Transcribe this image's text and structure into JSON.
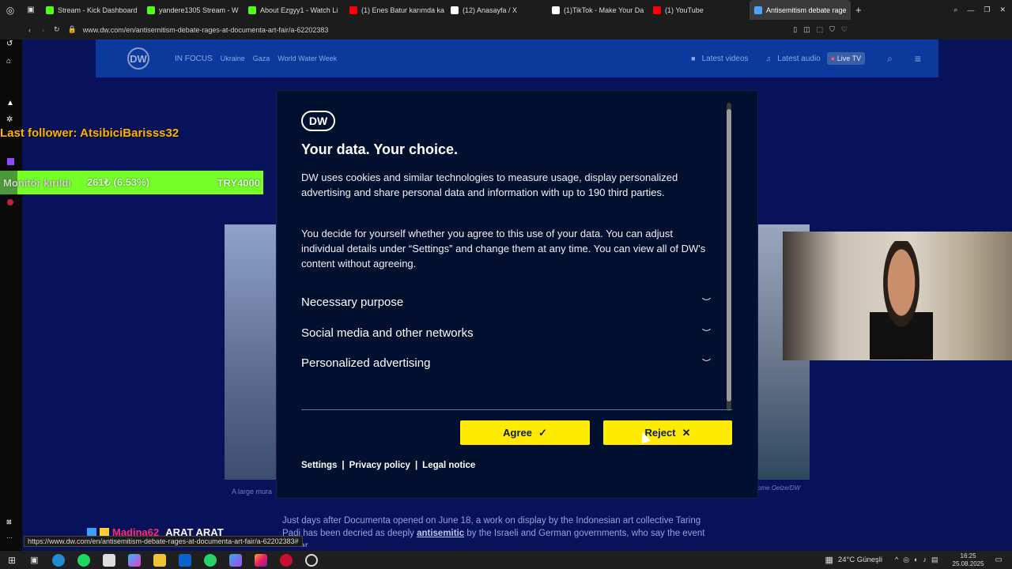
{
  "browser": {
    "tabs": [
      {
        "label": "Stream - Kick Dashboard",
        "color": "#53fc18",
        "icon": "kick-icon"
      },
      {
        "label": "yandere1305 Stream - W",
        "color": "#53fc18",
        "icon": "kick-icon"
      },
      {
        "label": "About Ezgyy1 - Watch Li",
        "color": "#53fc18",
        "icon": "kick-icon"
      },
      {
        "label": "(1) Enes Batur karımda ka",
        "color": "#ff0000",
        "icon": "youtube-icon"
      },
      {
        "label": "(12) Anasayfa / X",
        "color": "#ffffff",
        "icon": "x-icon"
      },
      {
        "label": "(1)TikTok - Make Your Da",
        "color": "#ffffff",
        "icon": "tiktok-icon"
      },
      {
        "label": "(1) YouTube",
        "color": "#ff0000",
        "icon": "youtube-icon"
      },
      {
        "label": "Antisemitism debate rage",
        "color": "#4aa3ff",
        "icon": "dw-icon",
        "active": true
      }
    ],
    "url": "www.dw.com/en/antisemitism-debate-rages-at-documenta-art-fair/a-62202383"
  },
  "stream_overlay": {
    "last_follower": "Last follower: AtsibiciBarisss32",
    "donation_label": "Monitör kırıldı",
    "donation_amount": "261₺ (6.53%)",
    "donation_goal": "TRY4000",
    "donation_progress": 0.0653,
    "bottom_name": "Madina62",
    "bottom_text": "ARAT ARAT"
  },
  "site": {
    "logo": "DW",
    "nav": {
      "in_focus": "IN FOCUS",
      "items": [
        "Ukraine",
        "Gaza",
        "World Water Week"
      ],
      "latest_videos": "Latest videos",
      "latest_audio": "Latest audio",
      "live_tv": "Live TV"
    },
    "caption_left": "A large mura",
    "caption_right": "ome Oelze/DW",
    "article_line1": "Just days after Documenta opened on June 18, a work on display by the Indonesian art collective Taring",
    "article_line2_pre": "Padi has been decried as deeply ",
    "article_line2_link": "antisemitic",
    "article_line2_post": " by the Israeli and German governments, who say the event",
    "article_line3": "too far"
  },
  "consent": {
    "logo": "DW",
    "title": "Your data. Your choice.",
    "para1": "DW uses cookies and similar technologies to measure usage, display personalized advertising and share personal data and information with up to 190 third parties.",
    "para2": "You decide for yourself whether you agree to this use of your data. You can adjust individual details under “Settings” and change them at any time. You can view all of DW's content without agreeing.",
    "sections": [
      "Necessary purpose",
      "Social media and other networks",
      "Personalized advertising"
    ],
    "agree": "Agree",
    "reject": "Reject",
    "links": [
      "Settings",
      "Privacy policy",
      "Legal notice"
    ],
    "accent": "#ffeb00"
  },
  "status_url": "https://www.dw.com/en/antisemitism-debate-rages-at-documenta-art-fair/a-62202383#",
  "taskbar": {
    "weather": "24°C Güneşli",
    "time": "16:25",
    "date": "25.08.2025"
  }
}
